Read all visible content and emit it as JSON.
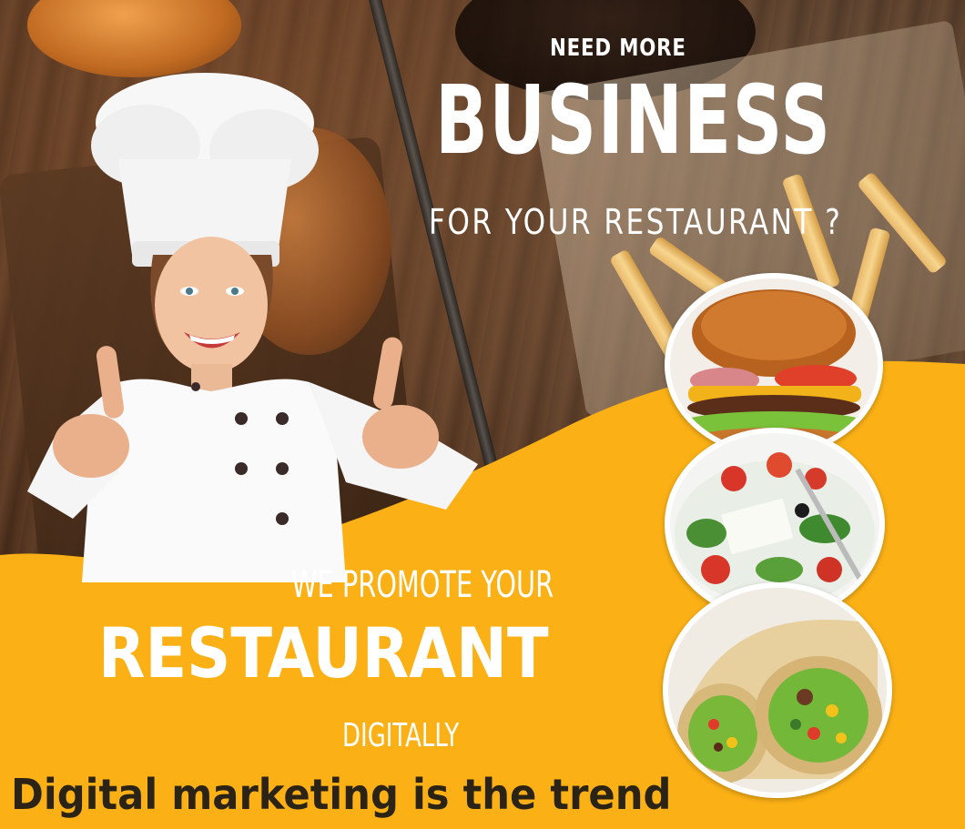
{
  "headline": {
    "line1": "NEED MORE",
    "line2": "BUSINESS",
    "line3": "FOR YOUR RESTAURANT ?"
  },
  "promo": {
    "line1": "WE PROMOTE YOUR",
    "line2": "RESTAURANT",
    "line3": "DIGITALLY"
  },
  "tagline": "Digital marketing is the trend",
  "colors": {
    "accent_yellow": "#fbb116",
    "background_wood": "#4a2f1e",
    "text_light": "#ffffff",
    "text_dark": "#2a2316"
  }
}
